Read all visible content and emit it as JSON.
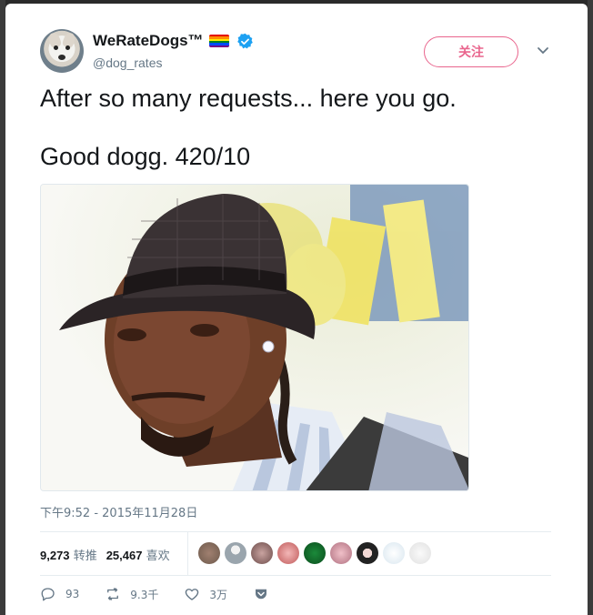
{
  "user": {
    "display_name": "WeRateDogs™",
    "handle": "@dog_rates",
    "avatar_icon": "dog-avatar",
    "verified": true
  },
  "follow_button": {
    "label": "关注",
    "color": "#e0245e"
  },
  "tweet": {
    "text": "After so many requests... here you go.\n\nGood dogg. 420/10",
    "timestamp": "下午9:52 - 2015年11月28日"
  },
  "stats": {
    "retweets_count": "9,273",
    "retweets_label": "转推",
    "likes_count": "25,467",
    "likes_label": "喜欢"
  },
  "actions": {
    "reply_count": "93",
    "retweet_count": "9.3千",
    "like_count": "3万"
  },
  "likers_count": 9,
  "colors": {
    "accent": "#1da1f2",
    "text": "#14171a",
    "muted": "#657786"
  }
}
